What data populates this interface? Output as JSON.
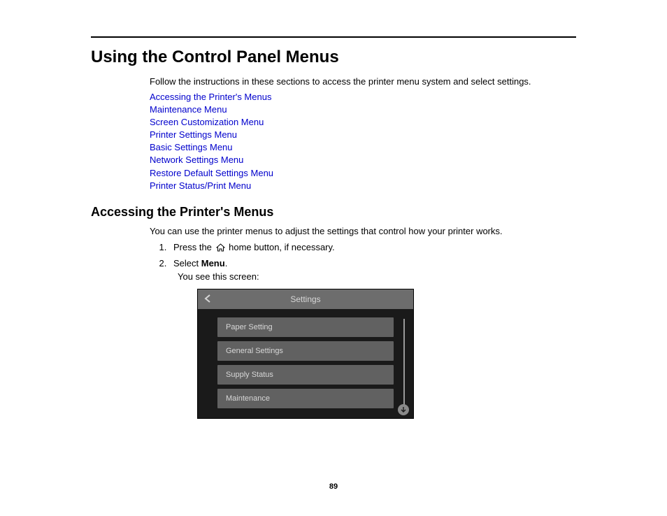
{
  "heading": "Using the Control Panel Menus",
  "intro": "Follow the instructions in these sections to access the printer menu system and select settings.",
  "links": [
    "Accessing the Printer's Menus",
    "Maintenance Menu",
    "Screen Customization Menu",
    "Printer Settings Menu",
    "Basic Settings Menu",
    "Network Settings Menu",
    "Restore Default Settings Menu",
    "Printer Status/Print Menu"
  ],
  "section2_heading": "Accessing the Printer's Menus",
  "section2_intro": "You can use the printer menus to adjust the settings that control how your printer works.",
  "step1_a": "Press the ",
  "step1_b": " home button, if necessary.",
  "step2_a": "Select ",
  "step2_b": "Menu",
  "step2_c": ".",
  "step2_note": "You see this screen:",
  "device": {
    "title": "Settings",
    "items": [
      "Paper Setting",
      "General Settings",
      "Supply Status",
      "Maintenance"
    ]
  },
  "page_number": "89"
}
